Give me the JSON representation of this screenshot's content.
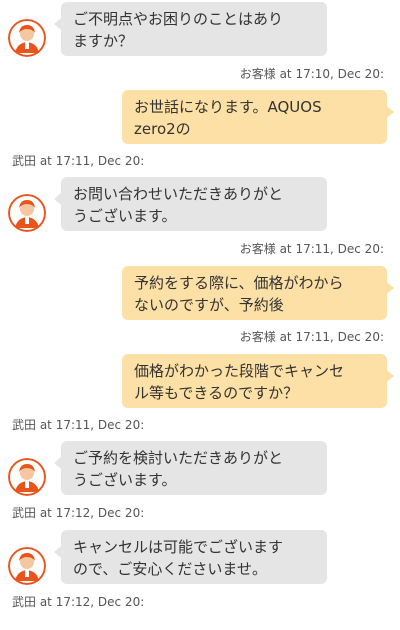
{
  "colors": {
    "agent_bubble": "#e5e5e5",
    "user_bubble": "#fde0a6",
    "avatar_orange": "#e8541b"
  },
  "messages": [
    {
      "from": "agent",
      "text": "ご不明点やお困りのことはあり\nますか？",
      "meta": ""
    },
    {
      "from": "user",
      "text": "お世話になります。AQUOS\nzero2の",
      "meta": "お客様 at 17:10, Dec 20:"
    },
    {
      "from": "agent",
      "text": "お問い合わせいただきありがと\nうございます。",
      "meta": "武田 at 17:11, Dec 20:"
    },
    {
      "from": "user",
      "text": "予約をする際に、価格がわから\nないのですが、予約後",
      "meta": "お客様 at 17:11, Dec 20:"
    },
    {
      "from": "user",
      "text": "価格がわかった段階でキャンセ\nル等もできるのですか？",
      "meta": "お客様 at 17:11, Dec 20:"
    },
    {
      "from": "agent",
      "text": "ご予約を検討いただきありがと\nうございます。",
      "meta": "武田 at 17:11, Dec 20:"
    },
    {
      "from": "agent",
      "text": "キャンセルは可能でございます\nので、ご安心くださいませ。",
      "meta": "武田 at 17:12, Dec 20:"
    }
  ],
  "trailing_meta": "武田 at 17:12, Dec 20:",
  "avatar_icon": "agent-avatar-icon"
}
